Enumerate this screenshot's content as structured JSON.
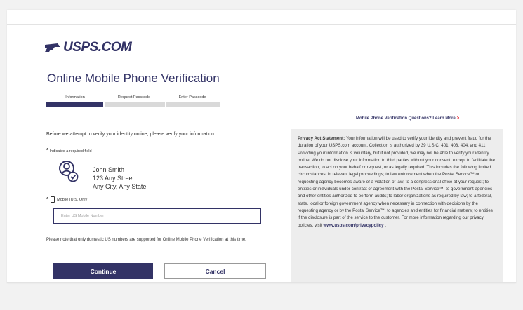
{
  "brand": {
    "logo_text": "USPS.COM",
    "navy": "#333366",
    "red": "#e71921"
  },
  "page": {
    "title": "Online Mobile Phone Verification"
  },
  "steps": [
    {
      "label": "Information",
      "active": true
    },
    {
      "label": "Request Passcode",
      "active": false
    },
    {
      "label": "Enter Passcode",
      "active": false
    }
  ],
  "help_link": {
    "label": "Mobile Phone Verification Questions? Learn More",
    "chevron": ">"
  },
  "form": {
    "intro": "Before we attempt to verify your identity online, please verify your information.",
    "required_marker": "*",
    "required_note": "Indicates a required field",
    "identity": {
      "icon": "user-check-icon",
      "name": "John Smith",
      "street": "123 Any Street",
      "city": "Any City, Any State"
    },
    "mobile_label": "Mobile (U.S. Only)",
    "mobile_placeholder": "Enter US Mobile Number",
    "mobile_value": "",
    "note": "Please note that only domestic US numbers are supported for Online Mobile Phone Verification at this time.",
    "continue_label": "Continue",
    "cancel_label": "Cancel"
  },
  "privacy": {
    "heading": "Privacy Act Statement:",
    "body": "Your information will be used to verify your identity and prevent fraud for the duration of your USPS.com account. Collection is authorized by 39 U.S.C. 401, 403, 404, and 411. Providing your information is voluntary, but if not provided, we may not be able to verify your identity online. We do not disclose your information to third parties without your consent, except to facilitate the transaction, to act on your behalf or request, or as legally required. This includes the following limited circumstances: in relevant legal proceedings; to law enforcement when the Postal Service™ or requesting agency becomes aware of a violation of law; to a congressional office at your request; to entities or individuals under contract or agreement with the Postal Service™; to government agencies and other entities authorized to perform audits; to labor organizations as required by law; to a federal, state, local or foreign government agency when necessary in connection with decisions by the requesting agency or by the Postal Service™; to agencies and entities for financial matters; to entities if the disclosure is part of the service to the customer. For more information regarding our privacy policies, visit",
    "url": "www.usps.com/privacypolicy",
    "end": " ."
  }
}
